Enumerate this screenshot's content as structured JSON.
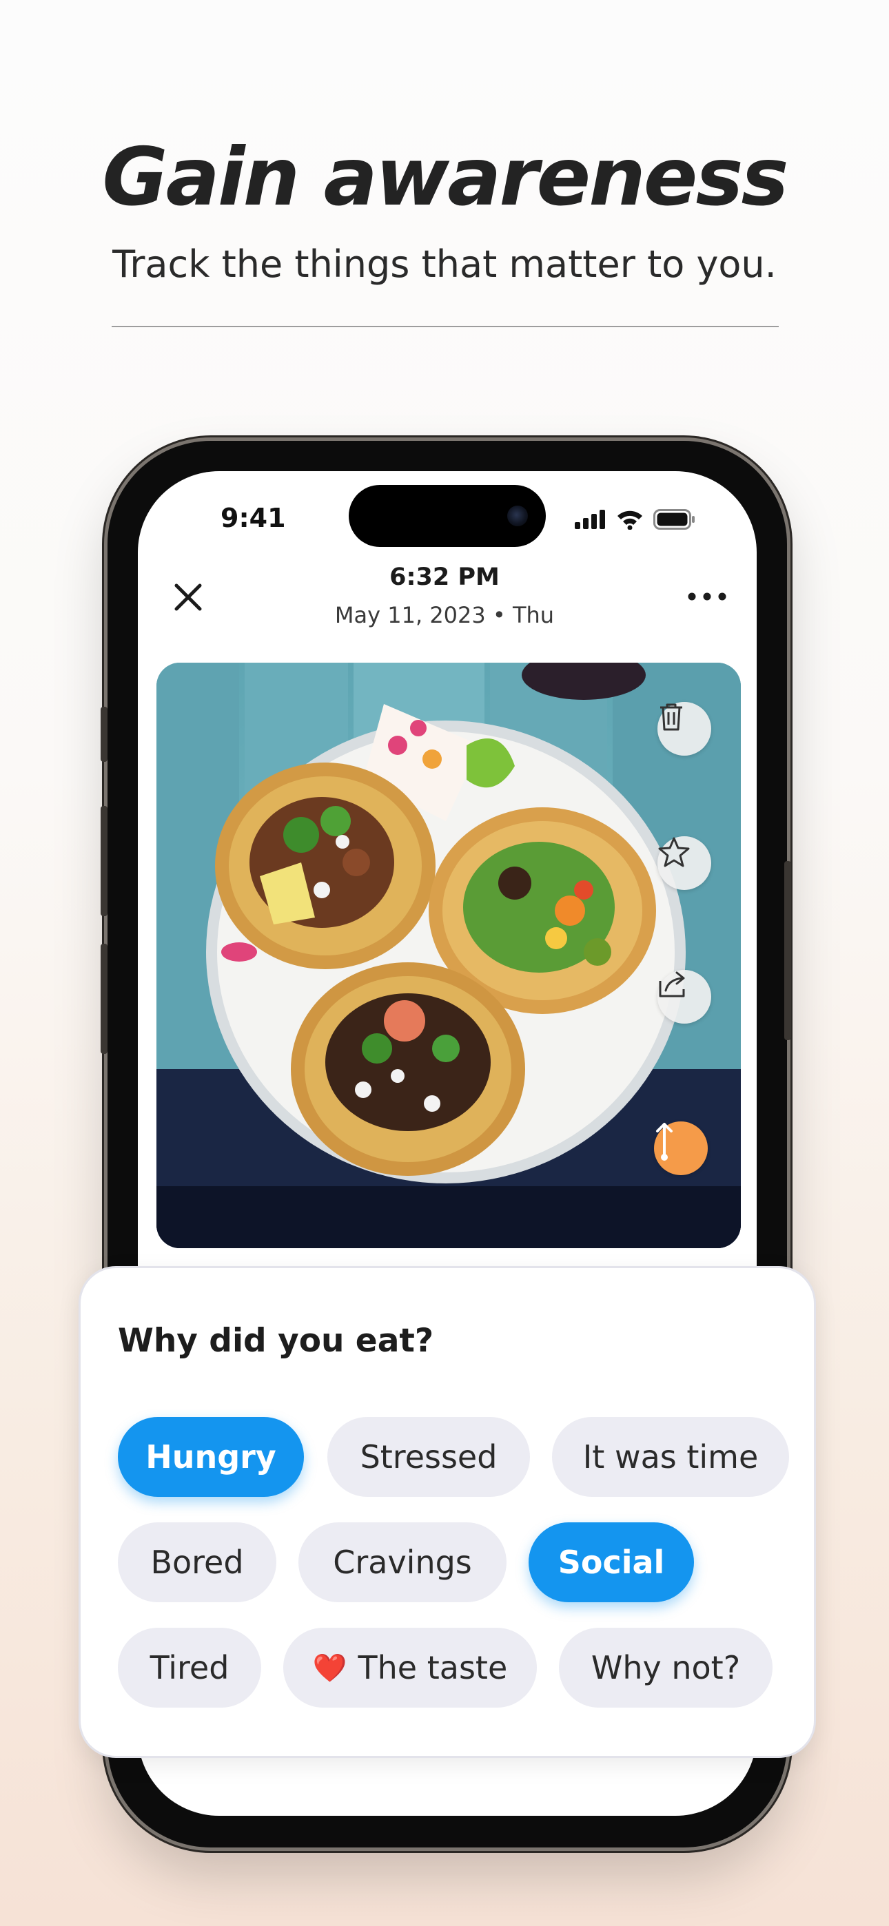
{
  "headline": "Gain awareness",
  "subheadline": "Track the things that matter to you.",
  "status_bar": {
    "time": "9:41",
    "icons": [
      "signal-icon",
      "wifi-icon",
      "battery-icon"
    ]
  },
  "entry_header": {
    "close_icon": "close-icon",
    "time": "6:32 PM",
    "date": "May 11, 2023 • Thu",
    "menu_icon": "more-horizontal-icon"
  },
  "photo": {
    "subject": "tacos",
    "actions": [
      {
        "name": "delete",
        "icon": "trash-icon"
      },
      {
        "name": "favorite",
        "icon": "star-icon"
      },
      {
        "name": "share",
        "icon": "share-icon"
      },
      {
        "name": "expand",
        "icon": "resize-vertical-icon"
      }
    ]
  },
  "question_card": {
    "title": "Why did you eat?",
    "options": [
      {
        "label": "Hungry",
        "selected": true
      },
      {
        "label": "Stressed",
        "selected": false
      },
      {
        "label": "It was time",
        "selected": false
      },
      {
        "label": "Bored",
        "selected": false
      },
      {
        "label": "Cravings",
        "selected": false
      },
      {
        "label": "Social",
        "selected": true
      },
      {
        "label": "Tired",
        "selected": false
      },
      {
        "label": "The taste",
        "selected": false,
        "emoji": "❤️"
      },
      {
        "label": "Why not?",
        "selected": false
      }
    ]
  },
  "colors": {
    "accent": "#1495ef",
    "orange": "#f59b49",
    "chip_background": "#ececf3",
    "heading": "#232323"
  }
}
